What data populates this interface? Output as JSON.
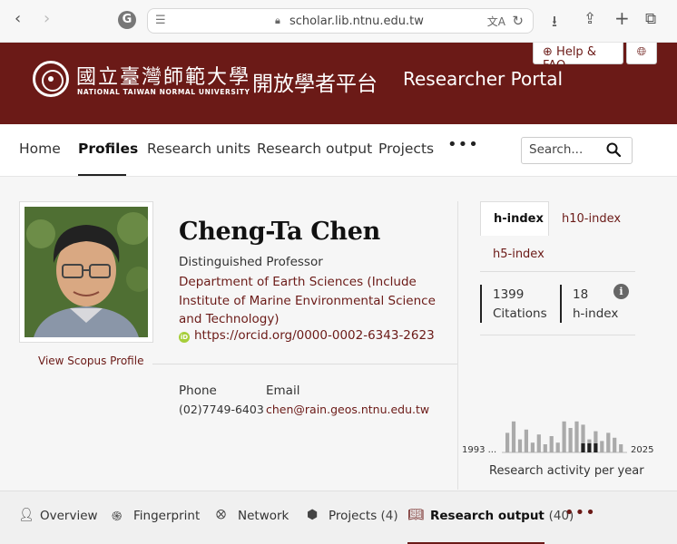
{
  "browser": {
    "url": "scholar.lib.ntnu.edu.tw",
    "icons": [
      "back-icon",
      "forward-icon",
      "grammarly-icon",
      "tab-overview-icon",
      "lock-icon",
      "translate-icon",
      "reload-icon",
      "download-icon",
      "share-icon",
      "new-tab-icon",
      "tabs-icon"
    ]
  },
  "header": {
    "university_cn": "國立臺灣師範大學",
    "university_en": "NATIONAL TAIWAN NORMAL UNIVERSITY",
    "portal_cn": "開放學者平台",
    "portal_en": "Researcher Portal",
    "help_label": "Help & FAQ",
    "brand_color": "#6b1a17"
  },
  "nav": {
    "items": [
      {
        "label": "Home"
      },
      {
        "label": "Profiles"
      },
      {
        "label": "Research units"
      },
      {
        "label": "Research output"
      },
      {
        "label": "Projects"
      }
    ],
    "active": "Profiles",
    "more": "•••",
    "search_placeholder": "Search..."
  },
  "profile": {
    "name": "Cheng-Ta Chen",
    "title": "Distinguished Professor",
    "department": "Department of Earth Sciences (Include Institute of Marine Environmental Science and Technology)",
    "orcid_badge": "iD",
    "orcid": "https://orcid.org/0000-0002-6343-2623",
    "scopus_link": "View Scopus Profile",
    "phone_label": "Phone",
    "phone": "(02)7749-6403",
    "email_label": "Email",
    "email": "chen@rain.geos.ntnu.edu.tw"
  },
  "metrics": {
    "tabs": [
      "h-index",
      "h10-index",
      "h5-index"
    ],
    "active_tab": "h-index",
    "citations_value": "1399",
    "citations_label": "Citations",
    "hindex_value": "18",
    "hindex_label": "h-index",
    "info": "i",
    "chart_start": "1993 ...",
    "chart_end": "2025",
    "chart_caption": "Research activity per year"
  },
  "chart_data": {
    "type": "bar",
    "x_range": [
      1993,
      2025
    ],
    "values": [
      0.6,
      0.95,
      0.4,
      0.7,
      0.3,
      0.55,
      0.25,
      0.5,
      0.3,
      0.95,
      0.75,
      0.95,
      0.85,
      0.4,
      0.65,
      0.35,
      0.6,
      0.45,
      0.25
    ],
    "highlight_from": 12,
    "highlight_to": 14,
    "bar_color": "#aaaaaa",
    "highlight_color": "#222222"
  },
  "bottom_tabs": [
    {
      "label": "Overview",
      "count": "",
      "icon": "person-icon"
    },
    {
      "label": "Fingerprint",
      "count": "",
      "icon": "fingerprint-icon"
    },
    {
      "label": "Network",
      "count": "",
      "icon": "network-icon"
    },
    {
      "label": "Projects",
      "count": "(4)",
      "icon": "cube-icon"
    },
    {
      "label": "Research output",
      "count": "(40)",
      "icon": "book-icon"
    }
  ],
  "bottom_active": "Research output",
  "bottom_more": "•••"
}
